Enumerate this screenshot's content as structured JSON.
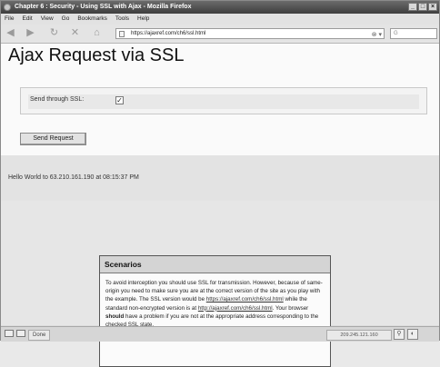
{
  "window": {
    "title": "Chapter 6 : Security - Using SSL with Ajax - Mozilla Firefox",
    "buttons": [
      "_",
      "□",
      "×"
    ]
  },
  "menu": [
    "File",
    "Edit",
    "View",
    "Go",
    "Bookmarks",
    "Tools",
    "Help"
  ],
  "toolbar": {
    "url": "https://ajaxref.com/ch6/ssl.html",
    "icons": [
      "back-icon",
      "forward-icon",
      "reload-icon",
      "stop-icon",
      "home-icon"
    ],
    "search_glyph": "G"
  },
  "page": {
    "title": "Ajax Request via SSL",
    "form": {
      "label": "Send through SSL:",
      "checked": true,
      "check_mark": "✓"
    },
    "send_button": "Send Request",
    "response": "Hello World to 63.210.161.190 at 08:15:37 PM",
    "scenarios": {
      "heading": "Scenarios",
      "p1": "To avoid interception you should use SSL for transmission. However, because of same-origin you need to make sure you are at the correct version of the site as you play with the example. The SSL version would be",
      "link_ssl": "https://ajaxref.com/ch6/ssl.html",
      "p2": "while the standard non-encrypted version is at",
      "link_plain": "http://ajaxref.com/ch6/ssl.html",
      "p3": ". Your browser",
      "strong": "should",
      "p4": "have a problem if you are not at the appropriate address corresponding to the checked SSL state."
    }
  },
  "status": {
    "text": "Done",
    "ip": "209.245.121.160"
  }
}
